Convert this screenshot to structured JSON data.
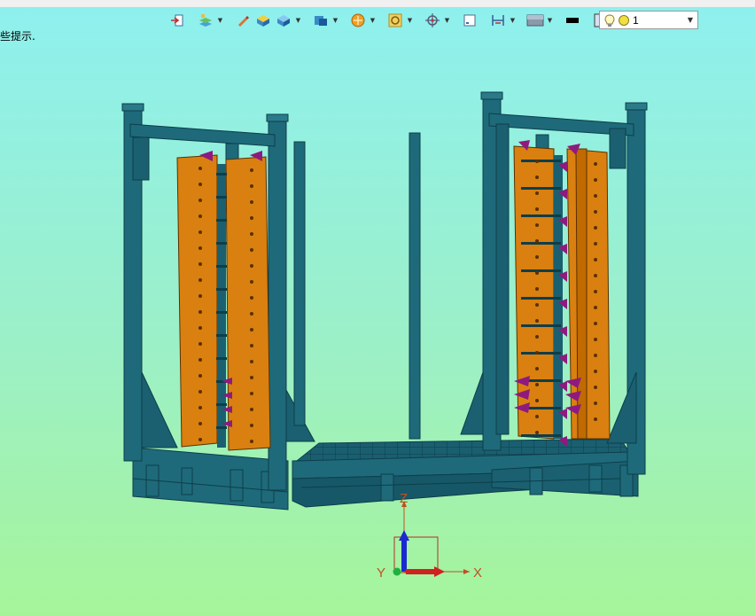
{
  "toolbar": {
    "icons": [
      "exit-icon",
      "layers-icon",
      "pencil-icon",
      "box-top-icon",
      "box-iso-icon",
      "view-orientation-icon",
      "shading-icon",
      "zoom-fit-icon",
      "orient-icon",
      "screen-icon",
      "section-icon",
      "background-icon",
      "line-color-icon",
      "fill-color-icon",
      "layers-stack-icon"
    ],
    "layer_combo": {
      "value": "1"
    }
  },
  "hint": {
    "text": "些提示."
  },
  "viewport": {
    "axes": {
      "z_label": "Z",
      "x_label": "X",
      "y_label": "Y"
    },
    "colors": {
      "frame": "#1e6a7a",
      "frame_dark": "#12505e",
      "plate": "#d98010",
      "clamp": "#8e1a80",
      "bg_top": "#8ef0ef",
      "bg_bottom": "#a6f49a"
    }
  }
}
